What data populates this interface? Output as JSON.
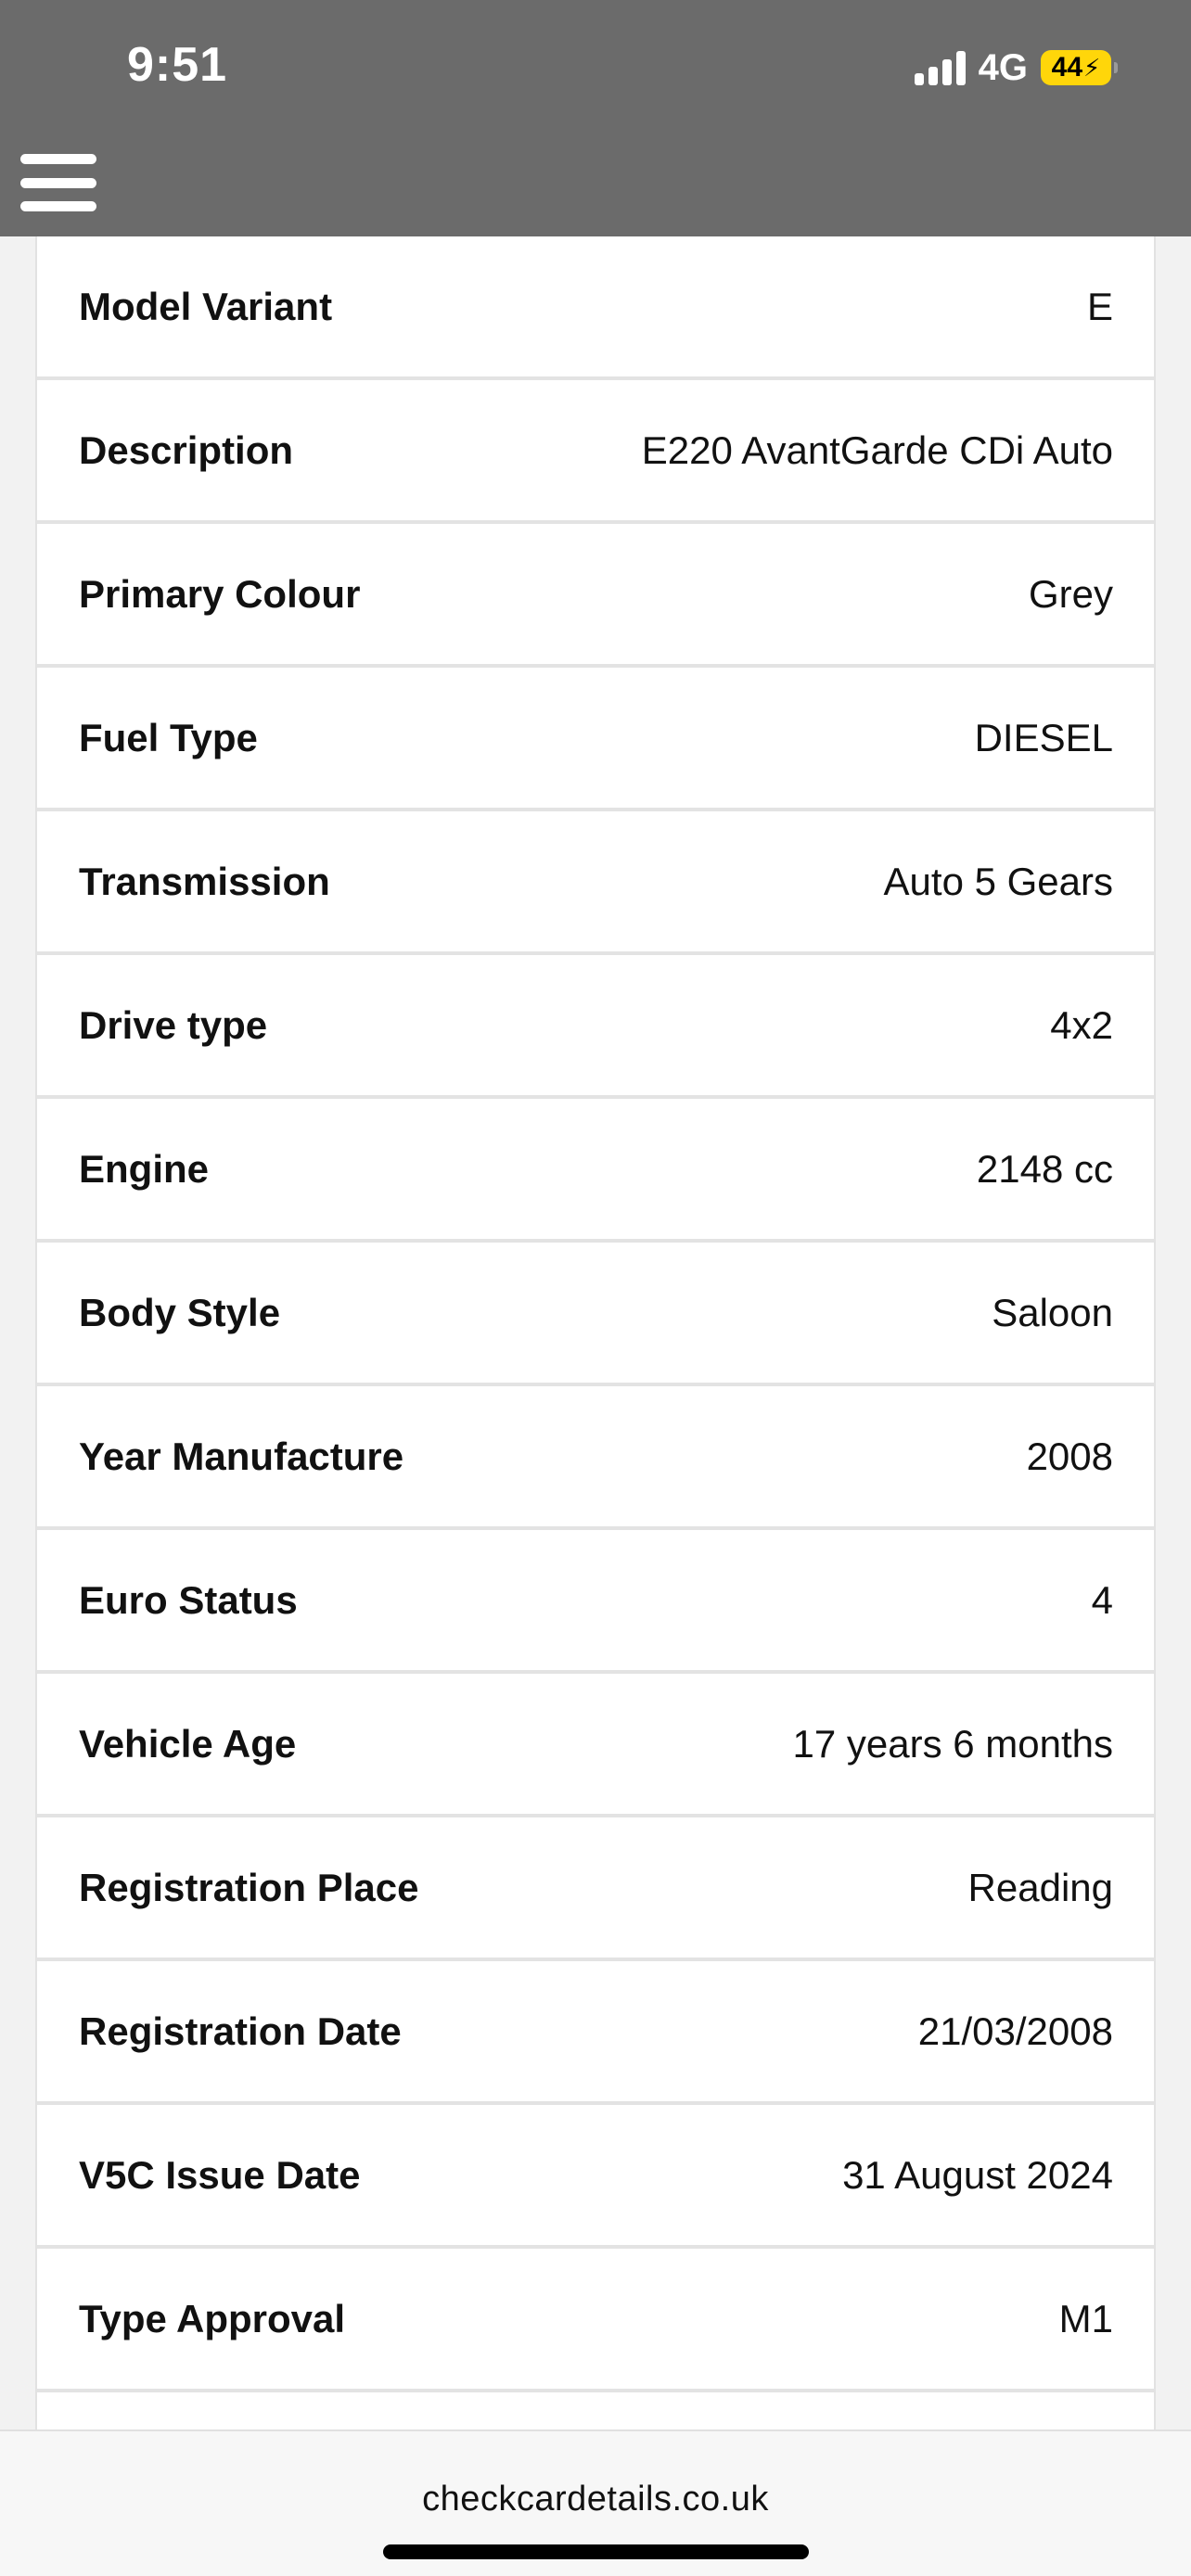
{
  "status_bar": {
    "time": "9:51",
    "network": "4G",
    "battery": "44",
    "battery_color": "#ffd60a"
  },
  "header": {
    "background": "#6b6b6b",
    "menu_icon": "hamburger-menu-icon"
  },
  "vehicle_details": [
    {
      "label": "Model Variant",
      "value": "E"
    },
    {
      "label": "Description",
      "value": "E220 AvantGarde CDi Auto"
    },
    {
      "label": "Primary Colour",
      "value": "Grey"
    },
    {
      "label": "Fuel Type",
      "value": "DIESEL"
    },
    {
      "label": "Transmission",
      "value": "Auto 5 Gears"
    },
    {
      "label": "Drive type",
      "value": "4x2"
    },
    {
      "label": "Engine",
      "value": "2148 cc"
    },
    {
      "label": "Body Style",
      "value": "Saloon"
    },
    {
      "label": "Year Manufacture",
      "value": "2008"
    },
    {
      "label": "Euro Status",
      "value": "4"
    },
    {
      "label": "Vehicle Age",
      "value": "17 years 6 months"
    },
    {
      "label": "Registration Place",
      "value": "Reading"
    },
    {
      "label": "Registration Date",
      "value": "21/03/2008"
    },
    {
      "label": "V5C Issue Date",
      "value": "31 August 2024"
    },
    {
      "label": "Type Approval",
      "value": "M1"
    }
  ],
  "browser": {
    "url": "checkcardetails.co.uk"
  }
}
